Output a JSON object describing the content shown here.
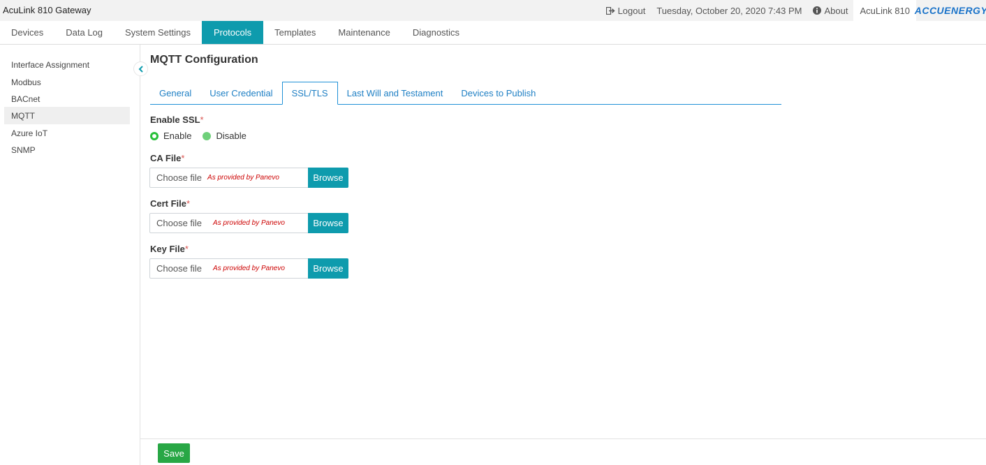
{
  "app": {
    "title": "AcuLink 810 Gateway"
  },
  "topbar": {
    "logout_label": "Logout",
    "datetime": "Tuesday, October 20, 2020 7:43 PM",
    "about_label": "About",
    "device_name": "AcuLink 810",
    "brand": "ACCUENERGY"
  },
  "nav": {
    "items": [
      "Devices",
      "Data Log",
      "System Settings",
      "Protocols",
      "Templates",
      "Maintenance",
      "Diagnostics"
    ],
    "active": "Protocols"
  },
  "sidebar": {
    "items": [
      "Interface Assignment",
      "Modbus",
      "BACnet",
      "MQTT",
      "Azure IoT",
      "SNMP"
    ],
    "active": "MQTT"
  },
  "main": {
    "title": "MQTT Configuration",
    "tabs": [
      "General",
      "User Credential",
      "SSL/TLS",
      "Last Will and Testament",
      "Devices to Publish"
    ],
    "active_tab": "SSL/TLS",
    "enable_ssl": {
      "label": "Enable SSL",
      "options": [
        "Enable",
        "Disable"
      ],
      "selected": "Enable"
    },
    "files": [
      {
        "label": "CA File",
        "choose_label": "Choose file",
        "hint": "As provided by Panevo",
        "browse_label": "Browse"
      },
      {
        "label": "Cert File",
        "choose_label": "Choose file",
        "hint": "As provided by Panevo",
        "browse_label": "Browse"
      },
      {
        "label": "Key File",
        "choose_label": "Choose file",
        "hint": "As provided by Panevo",
        "browse_label": "Browse"
      }
    ],
    "required_mark": "*"
  },
  "footer": {
    "save_label": "Save"
  },
  "colors": {
    "accent": "#0e9bad",
    "tab_blue": "#1e7fc4",
    "success": "#28a745",
    "required": "#d9534f",
    "hint": "#cc0000"
  }
}
